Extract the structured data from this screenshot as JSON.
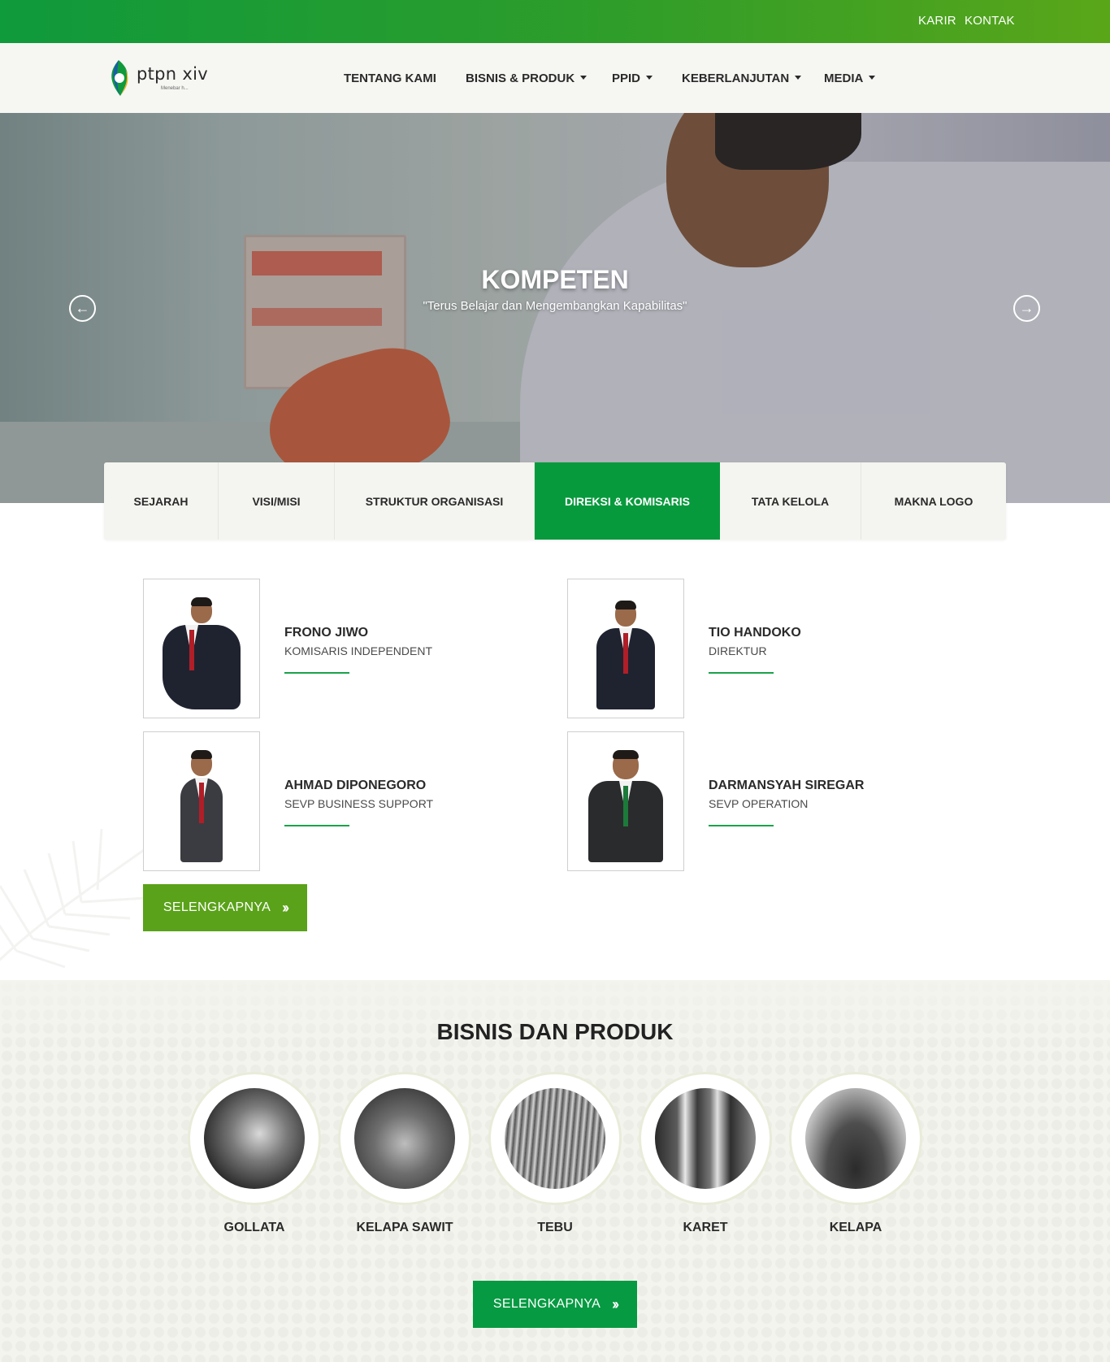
{
  "topbar": {
    "links": [
      "KARIR",
      "KONTAK"
    ]
  },
  "brand": {
    "name": "ptpn xiv",
    "tagline": "Menebar h..."
  },
  "nav": {
    "items": [
      {
        "label": "TENTANG KAMI",
        "dropdown": false
      },
      {
        "label": "BISNIS & PRODUK",
        "dropdown": true
      },
      {
        "label": "PPID",
        "dropdown": true
      },
      {
        "label": "KEBERLANJUTAN",
        "dropdown": true
      },
      {
        "label": "MEDIA",
        "dropdown": true
      }
    ]
  },
  "hero": {
    "title": "KOMPETEN",
    "subtitle": "\"Terus Belajar dan Mengembangkan Kapabilitas\"",
    "prev_icon": "arrow-left-circle-icon",
    "next_icon": "arrow-right-circle-icon"
  },
  "tabs": {
    "items": [
      "SEJARAH",
      "VISI/MISI",
      "STRUKTUR ORGANISASI",
      "DIREKSI & KOMISARIS",
      "TATA KELOLA",
      "MAKNA LOGO"
    ],
    "active": "DIREKSI & KOMISARIS"
  },
  "board": {
    "members": [
      {
        "name": "FRONO JIWO",
        "role": "KOMISARIS INDEPENDENT"
      },
      {
        "name": "TIO HANDOKO",
        "role": "DIREKTUR"
      },
      {
        "name": "AHMAD DIPONEGORO",
        "role": "SEVP BUSINESS SUPPORT"
      },
      {
        "name": "DARMANSYAH SIREGAR",
        "role": "SEVP OPERATION"
      }
    ],
    "more_label": "SELENGKAPNYA"
  },
  "products": {
    "title": "BISNIS DAN PRODUK",
    "items": [
      "GOLLATA",
      "KELAPA SAWIT",
      "TEBU",
      "KARET",
      "KELAPA"
    ],
    "more_label": "SELENGKAPNYA"
  },
  "colors": {
    "topbar_start": "#0f9a3c",
    "topbar_end": "#5aa619",
    "accent_green": "#079a3d",
    "lime_button": "#5aa219",
    "section_bg": "#f4f4ef"
  }
}
